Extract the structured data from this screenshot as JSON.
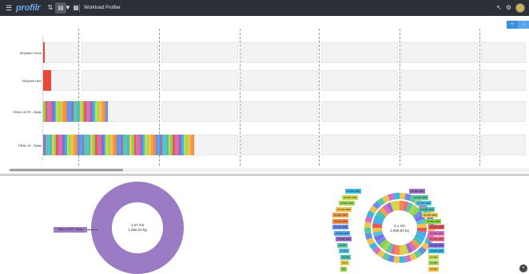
{
  "topbar": {
    "logo": "profilr",
    "page_title": "Workload Profiler",
    "icons": [
      "menu-icon",
      "sort-icon",
      "chart-view-icon",
      "filter-icon",
      "table-view-icon",
      "pin-icon",
      "settings-icon"
    ]
  },
  "view_toggle": {
    "left": "+",
    "right": "−"
  },
  "chart_data": {
    "type": "bar",
    "orientation": "horizontal",
    "stacked": true,
    "categories": [
      "MSystem Sand",
      "MSystem Bar",
      "EBAs 16 ER - Bylay",
      "EBAs 16 - Bylay"
    ],
    "segment_counts": [
      1,
      3,
      30,
      70
    ],
    "grid": true,
    "colors": {
      "primary_segment": "#e8473c",
      "palette": [
        "#f08a4b",
        "#3cb8e0",
        "#8fd14f",
        "#9b6fc4",
        "#f2c14e",
        "#e86a8a",
        "#4fc0b0",
        "#6b8de8",
        "#c9d94a",
        "#e05b5b",
        "#5ec6a0",
        "#f0a04b",
        "#7a6fe0",
        "#e8c84f",
        "#4fa8e8",
        "#a4d65e",
        "#d86fc0",
        "#55c2d9"
      ]
    }
  },
  "donut_left": {
    "center_line1": "1,67 mh",
    "center_line2": "1.066,24 kg",
    "legend_label": "EBAs 16 ER - Bylay",
    "color": "#9b7cc4"
  },
  "donut_right": {
    "center_line1": "4,1 mh",
    "center_line2": "4.005,93 kg",
    "labels_left": [
      "XX-8%-16IZ",
      "XX-8%-16IZ",
      "XX-8%-16IZ",
      "XX-8%-16IZ",
      "XX-8%-16IZ",
      "XX-8%-16IZ",
      "XX-8%-16IZ",
      "XX-8%-16IZ",
      "XX-8%-16IZ",
      "XX-8%",
      "XX-8%",
      "XX-8%",
      "XX-8",
      "XX"
    ],
    "labels_right": [
      "XX-8%-16IZ",
      "XX-8%-16IZ",
      "XX-8%-16IZ",
      "XX-8%-16IZ",
      "XX-8%-16IZ",
      "XX-8%-16IZ",
      "XX-8%-16IZ",
      "XX-8%-16IZ",
      "XX-8%-16IZ",
      "XX-8%-16IZ",
      "XX-8%-16IZ",
      "XX-8%",
      "XX-8%",
      "XX-8%"
    ]
  },
  "fab": "+"
}
